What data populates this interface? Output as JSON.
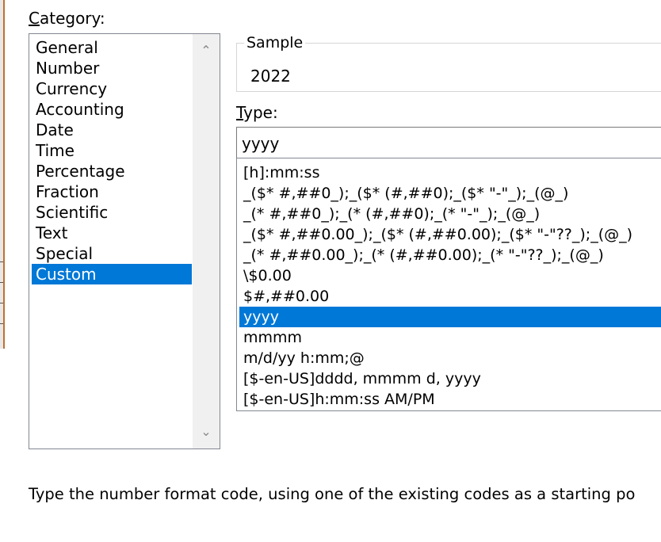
{
  "category": {
    "label_underlined": "C",
    "label_rest": "ategory:",
    "items": [
      "General",
      "Number",
      "Currency",
      "Accounting",
      "Date",
      "Time",
      "Percentage",
      "Fraction",
      "Scientific",
      "Text",
      "Special",
      "Custom"
    ],
    "selected": "Custom"
  },
  "sample": {
    "legend": "Sample",
    "value": "2022"
  },
  "type": {
    "label_underlined": "T",
    "label_rest": "ype:",
    "input_value": "yyyy",
    "items": [
      "[h]:mm:ss",
      "_($* #,##0_);_($* (#,##0);_($* \"-\"_);_(@_)",
      "_(* #,##0_);_(* (#,##0);_(* \"-\"_);_(@_)",
      "_($* #,##0.00_);_($* (#,##0.00);_($* \"-\"??_);_(@_)",
      "_(* #,##0.00_);_(* (#,##0.00);_(* \"-\"??_);_(@_)",
      "\\$0.00",
      "$#,##0.00",
      "yyyy",
      "mmmm",
      "m/d/yy h:mm;@",
      "[$-en-US]dddd, mmmm d, yyyy",
      "[$-en-US]h:mm:ss AM/PM"
    ],
    "selected": "yyyy"
  },
  "hint": "Type the number format code, using one of the existing codes as a starting po",
  "colors": {
    "selection": "#0078d7",
    "border": "#828790"
  },
  "icons": {
    "scroll_up": "chevron-up-icon",
    "scroll_down": "chevron-down-icon"
  }
}
